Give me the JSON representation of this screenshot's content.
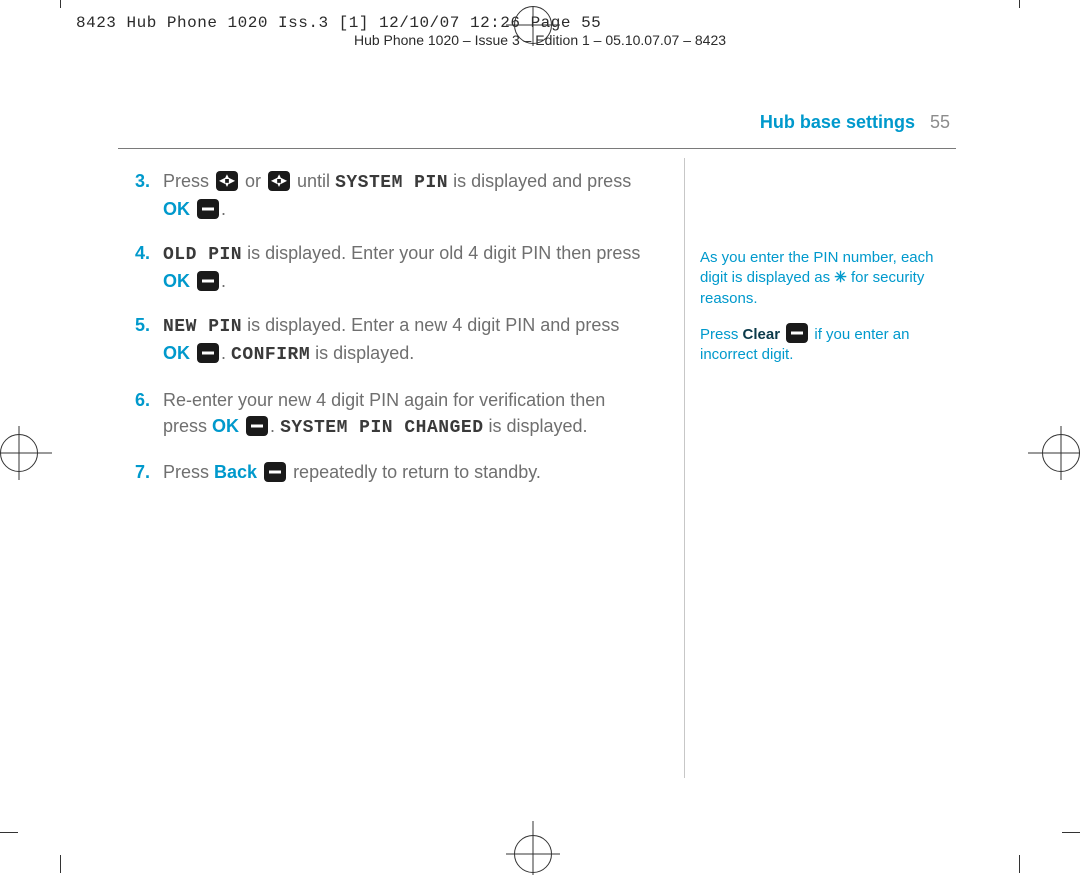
{
  "print_slug_outer": "8423 Hub Phone 1020 Iss.3 [1]  12/10/07  12:26  Page 55",
  "print_slug_inner": "Hub Phone 1020 – Issue 3 – Edition 1 – 05.10.07.07 – 8423",
  "header": {
    "title": "Hub base settings",
    "page_number": "55"
  },
  "steps": [
    {
      "num": "3.",
      "parts": [
        {
          "t": "text",
          "v": "Press "
        },
        {
          "t": "key",
          "v": "nav"
        },
        {
          "t": "text",
          "v": " or "
        },
        {
          "t": "key",
          "v": "nav"
        },
        {
          "t": "text",
          "v": " until "
        },
        {
          "t": "lcd",
          "v": "SYSTEM PIN"
        },
        {
          "t": "text",
          "v": " is displayed and press "
        },
        {
          "t": "bold-blue",
          "v": "OK"
        },
        {
          "t": "text",
          "v": " "
        },
        {
          "t": "key",
          "v": "minus"
        },
        {
          "t": "text",
          "v": "."
        }
      ]
    },
    {
      "num": "4.",
      "parts": [
        {
          "t": "lcd",
          "v": "OLD PIN"
        },
        {
          "t": "text",
          "v": " is displayed. Enter your old 4 digit PIN then press "
        },
        {
          "t": "bold-blue",
          "v": "OK"
        },
        {
          "t": "text",
          "v": " "
        },
        {
          "t": "key",
          "v": "minus"
        },
        {
          "t": "text",
          "v": "."
        }
      ]
    },
    {
      "num": "5.",
      "parts": [
        {
          "t": "lcd",
          "v": "NEW PIN"
        },
        {
          "t": "text",
          "v": " is displayed. Enter a new 4 digit PIN and press "
        },
        {
          "t": "bold-blue",
          "v": "OK"
        },
        {
          "t": "text",
          "v": " "
        },
        {
          "t": "key",
          "v": "minus"
        },
        {
          "t": "text",
          "v": ". "
        },
        {
          "t": "lcd",
          "v": "CONFIRM"
        },
        {
          "t": "text",
          "v": " is displayed."
        }
      ]
    },
    {
      "num": "6.",
      "parts": [
        {
          "t": "text",
          "v": "Re-enter your new 4 digit PIN again for verification then press "
        },
        {
          "t": "bold-blue",
          "v": "OK"
        },
        {
          "t": "text",
          "v": " "
        },
        {
          "t": "key",
          "v": "minus"
        },
        {
          "t": "text",
          "v": ". "
        },
        {
          "t": "lcd",
          "v": "SYSTEM PIN CHANGED"
        },
        {
          "t": "text",
          "v": " is displayed."
        }
      ]
    },
    {
      "num": "7.",
      "parts": [
        {
          "t": "text",
          "v": "Press "
        },
        {
          "t": "bold-blue",
          "v": "Back"
        },
        {
          "t": "text",
          "v": " "
        },
        {
          "t": "key",
          "v": "minus"
        },
        {
          "t": "text",
          "v": " repeatedly to return to standby."
        }
      ]
    }
  ],
  "sidebar": {
    "note1_a": "As you enter the PIN number, each digit is displayed as ",
    "note1_star": "✳",
    "note1_b": " for security reasons.",
    "note2_a": "Press ",
    "note2_clear": "Clear",
    "note2_b": " if you enter an incorrect digit."
  }
}
